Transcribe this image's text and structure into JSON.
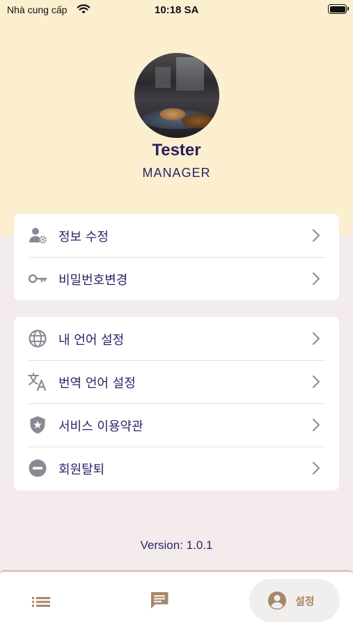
{
  "status_bar": {
    "carrier": "Nhà cung cấp",
    "time": "10:18 SA"
  },
  "profile": {
    "name": "Tester",
    "role": "MANAGER"
  },
  "account_menu": [
    {
      "label": "정보 수정",
      "icon": "user-gear-icon"
    },
    {
      "label": "비밀번호변경",
      "icon": "key-icon"
    }
  ],
  "settings_menu": [
    {
      "label": "내 언어 설정",
      "icon": "globe-icon"
    },
    {
      "label": "번역 언어 설정",
      "icon": "translate-icon"
    },
    {
      "label": "서비스 이용약관",
      "icon": "shield-star-icon"
    },
    {
      "label": "회원탈퇴",
      "icon": "minus-circle-icon"
    }
  ],
  "version": "Version: 1.0.1",
  "tab_bar": {
    "items": [
      {
        "icon": "list-icon"
      },
      {
        "icon": "chat-icon"
      },
      {
        "icon": "account-circle-icon",
        "label": "설정",
        "active": true
      }
    ]
  },
  "colors": {
    "header_bg": "#fbefd0",
    "page_bg": "#f4ecec",
    "text_primary": "#2d2467",
    "icon_gray": "#8a8a96",
    "tab_accent": "#a5876a"
  }
}
